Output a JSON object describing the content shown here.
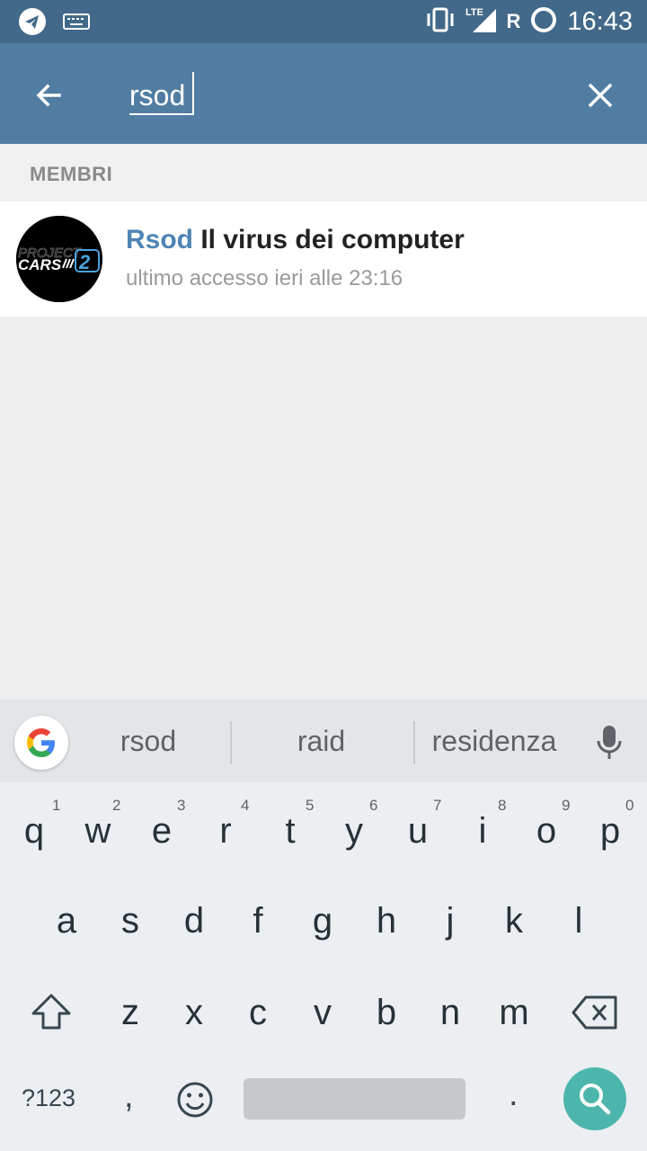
{
  "status_bar": {
    "time": "16:43",
    "roaming": "R",
    "network": "LTE"
  },
  "app_bar": {
    "search_value": "rsod"
  },
  "section": {
    "title": "MEMBRI"
  },
  "results": [
    {
      "name_highlight": "Rsod",
      "name_rest": " Il virus dei computer",
      "last_seen": "ultimo accesso ieri alle 23:16",
      "avatar_text_1": "PROJECT",
      "avatar_text_2": "CARS",
      "avatar_text_3": "2"
    }
  ],
  "keyboard": {
    "suggestions": [
      "rsod",
      "raid",
      "residenza"
    ],
    "row1": [
      "q",
      "w",
      "e",
      "r",
      "t",
      "y",
      "u",
      "i",
      "o",
      "p"
    ],
    "row1_hints": [
      "1",
      "2",
      "3",
      "4",
      "5",
      "6",
      "7",
      "8",
      "9",
      "0"
    ],
    "row2": [
      "a",
      "s",
      "d",
      "f",
      "g",
      "h",
      "j",
      "k",
      "l"
    ],
    "row3": [
      "z",
      "x",
      "c",
      "v",
      "b",
      "n",
      "m"
    ],
    "symbols_label": "?123",
    "comma": ",",
    "period": "."
  },
  "colors": {
    "status_bar": "#426989",
    "app_bar": "#527da3",
    "highlight": "#4f84b5",
    "search_key": "#4db6ac"
  }
}
